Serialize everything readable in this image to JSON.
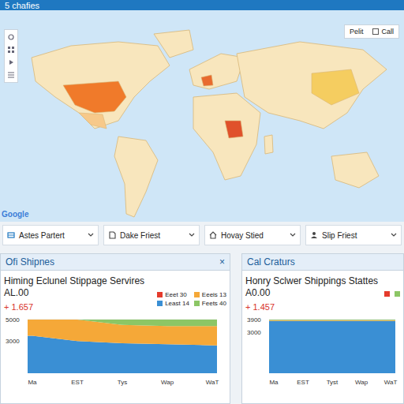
{
  "header": {
    "title": "5 chafies"
  },
  "map": {
    "highlights": [
      {
        "region": "usa",
        "color": "#f07a2a"
      },
      {
        "region": "mexico",
        "color": "#f7c98a"
      },
      {
        "region": "china",
        "color": "#f5cd60"
      },
      {
        "region": "east-africa",
        "color": "#e0512b"
      },
      {
        "region": "europe-south",
        "color": "#e86a2e"
      }
    ],
    "box": {
      "items": [
        "Pelit",
        "Call"
      ]
    },
    "watermark": "Google"
  },
  "filters": [
    {
      "label": "Astes Partert"
    },
    {
      "label": "Dake Friest"
    },
    {
      "label": "Hovay Stied"
    },
    {
      "label": "Slip Friest"
    }
  ],
  "panels": [
    {
      "header": "Ofi Shipnes",
      "close": "×",
      "title": "Himing Eclunel Stippage Servires AL.00",
      "value": "+ 1.657",
      "legend": [
        {
          "label": "Eeet 30",
          "color": "#e53b2c"
        },
        {
          "label": "Eeeis 13",
          "color": "#f5a838"
        },
        {
          "label": "Least 14",
          "color": "#3a8fd4"
        },
        {
          "label": "Feets 40",
          "color": "#8cc665"
        }
      ],
      "chart": {
        "y_ticks": [
          "5000",
          "3000"
        ],
        "x_labels": [
          "Ma",
          "EST",
          "Tys",
          "Wap",
          "WaT"
        ],
        "series": [
          {
            "color": "#3a8fd4",
            "values": [
              3500,
              3000,
              2800,
              2700,
              2600
            ]
          },
          {
            "color": "#f5a838",
            "values": [
              1500,
              2000,
              1700,
              1700,
              1800
            ]
          },
          {
            "color": "#8cc665",
            "values": [
              0,
              0,
              500,
              600,
              600
            ]
          }
        ]
      }
    },
    {
      "header": "Cal Craturs",
      "close": "",
      "title": "Honry Sclwer Shippings Stattes A0.00",
      "value": "+ 1.457",
      "legend": [
        {
          "label": "",
          "color": "#e53b2c"
        },
        {
          "label": "",
          "color": "#8cc665"
        }
      ],
      "chart": {
        "y_ticks": [
          "3900",
          "3000"
        ],
        "x_labels": [
          "Ma",
          "EST",
          "Tyst",
          "Wap",
          "WaT"
        ],
        "series": [
          {
            "color": "#3a8fd4",
            "values": [
              3800,
              3800,
              3800,
              3800,
              3800
            ]
          },
          {
            "color": "#f5a838",
            "values": [
              50,
              50,
              60,
              60,
              60
            ]
          },
          {
            "color": "#8cc665",
            "values": [
              50,
              50,
              40,
              40,
              40
            ]
          }
        ]
      }
    }
  ]
}
